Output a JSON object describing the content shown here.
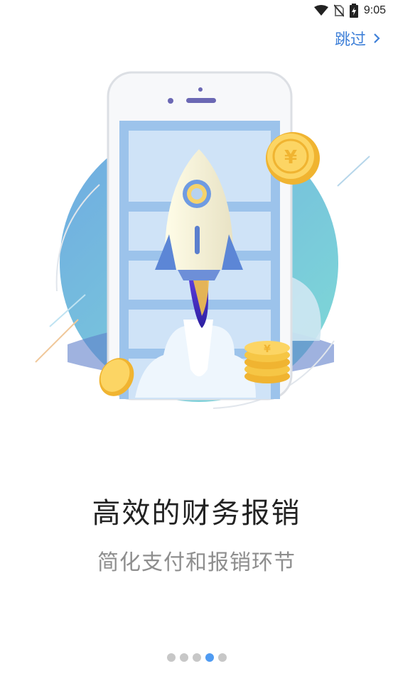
{
  "status_bar": {
    "time": "9:05",
    "icons": [
      "wifi-icon",
      "no-sim-icon",
      "battery-icon"
    ]
  },
  "skip": {
    "label": "跳过",
    "icon": "chevron-right-icon"
  },
  "content": {
    "title": "高效的财务报销",
    "subtitle": "简化支付和报销环节"
  },
  "pager": {
    "total": 5,
    "active_index": 3
  },
  "colors": {
    "accent": "#3f80d8",
    "dot_active": "#4f9bf2",
    "dot_inactive": "#c7c7c7"
  }
}
